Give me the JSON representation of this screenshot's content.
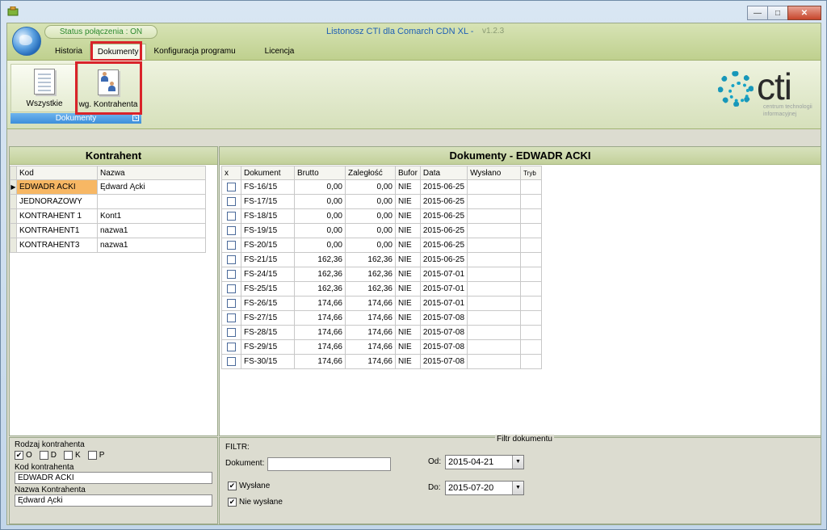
{
  "window": {
    "minimize": "—",
    "maximize": "□",
    "close": "✕"
  },
  "header": {
    "status": "Status połączenia : ON",
    "title": "Listonosz CTI dla Comarch CDN XL -",
    "version": "v1.2.3",
    "tabs": [
      "Historia",
      "Dokumenty",
      "Konfiguracja programu",
      "Licencja"
    ],
    "active_tab": "Dokumenty"
  },
  "ribbon": {
    "buttons": [
      "Wszystkie",
      "wg. Kontrahenta"
    ],
    "group_label": "Dokumenty",
    "logo_text": "cti",
    "logo_sub": "centrum technologii informacyjnej"
  },
  "kontrahent_panel": {
    "title": "Kontrahent",
    "columns": [
      "Kod",
      "Nazwa"
    ],
    "rows": [
      {
        "kod": "EDWADR ACKI",
        "nazwa": "Ędward Ącki"
      },
      {
        "kod": "JEDNORAZOWY",
        "nazwa": ""
      },
      {
        "kod": "KONTRAHENT 1",
        "nazwa": "Kont1"
      },
      {
        "kod": "KONTRAHENT1",
        "nazwa": "nazwa1"
      },
      {
        "kod": "KONTRAHENT3",
        "nazwa": "nazwa1"
      }
    ]
  },
  "dokumenty_panel": {
    "title": "Dokumenty - EDWADR ACKI",
    "columns": [
      "x",
      "Dokument",
      "Brutto",
      "Zaległość",
      "Bufor",
      "Data",
      "Wysłano",
      "Tryb"
    ],
    "rows": [
      {
        "dokument": "FS-16/15",
        "brutto": "0,00",
        "zaleglosc": "0,00",
        "bufor": "NIE",
        "data": "2015-06-25"
      },
      {
        "dokument": "FS-17/15",
        "brutto": "0,00",
        "zaleglosc": "0,00",
        "bufor": "NIE",
        "data": "2015-06-25"
      },
      {
        "dokument": "FS-18/15",
        "brutto": "0,00",
        "zaleglosc": "0,00",
        "bufor": "NIE",
        "data": "2015-06-25"
      },
      {
        "dokument": "FS-19/15",
        "brutto": "0,00",
        "zaleglosc": "0,00",
        "bufor": "NIE",
        "data": "2015-06-25"
      },
      {
        "dokument": "FS-20/15",
        "brutto": "0,00",
        "zaleglosc": "0,00",
        "bufor": "NIE",
        "data": "2015-06-25"
      },
      {
        "dokument": "FS-21/15",
        "brutto": "162,36",
        "zaleglosc": "162,36",
        "bufor": "NIE",
        "data": "2015-06-25"
      },
      {
        "dokument": "FS-24/15",
        "brutto": "162,36",
        "zaleglosc": "162,36",
        "bufor": "NIE",
        "data": "2015-07-01"
      },
      {
        "dokument": "FS-25/15",
        "brutto": "162,36",
        "zaleglosc": "162,36",
        "bufor": "NIE",
        "data": "2015-07-01"
      },
      {
        "dokument": "FS-26/15",
        "brutto": "174,66",
        "zaleglosc": "174,66",
        "bufor": "NIE",
        "data": "2015-07-01"
      },
      {
        "dokument": "FS-27/15",
        "brutto": "174,66",
        "zaleglosc": "174,66",
        "bufor": "NIE",
        "data": "2015-07-08"
      },
      {
        "dokument": "FS-28/15",
        "brutto": "174,66",
        "zaleglosc": "174,66",
        "bufor": "NIE",
        "data": "2015-07-08"
      },
      {
        "dokument": "FS-29/15",
        "brutto": "174,66",
        "zaleglosc": "174,66",
        "bufor": "NIE",
        "data": "2015-07-08"
      },
      {
        "dokument": "FS-30/15",
        "brutto": "174,66",
        "zaleglosc": "174,66",
        "bufor": "NIE",
        "data": "2015-07-08"
      }
    ]
  },
  "left_filter": {
    "rodzaj_label": "Rodzaj kontrahenta",
    "rodzaj_options": [
      {
        "label": "O",
        "checked": true
      },
      {
        "label": "D",
        "checked": false
      },
      {
        "label": "K",
        "checked": false
      },
      {
        "label": "P",
        "checked": false
      }
    ],
    "kod_label": "Kod kontrahenta",
    "kod_value": "EDWADR ACKI",
    "nazwa_label": "Nazwa Kontrahenta",
    "nazwa_value": "Ędward Ącki"
  },
  "right_filter": {
    "group_title": "Filtr dokumentu",
    "filtr_label": "FILTR:",
    "dokument_label": "Dokument:",
    "dokument_value": "",
    "wyslane_label": "Wysłane",
    "nie_wyslane_label": "Nie wysłane",
    "od_label": "Od:",
    "od_value": "2015-04-21",
    "do_label": "Do:",
    "do_value": "2015-07-20"
  },
  "colors": {
    "highlight_red": "#d9232a",
    "selected_row": "#f7b764",
    "status_green": "#2d8a2d",
    "title_blue": "#1e5fb5"
  }
}
